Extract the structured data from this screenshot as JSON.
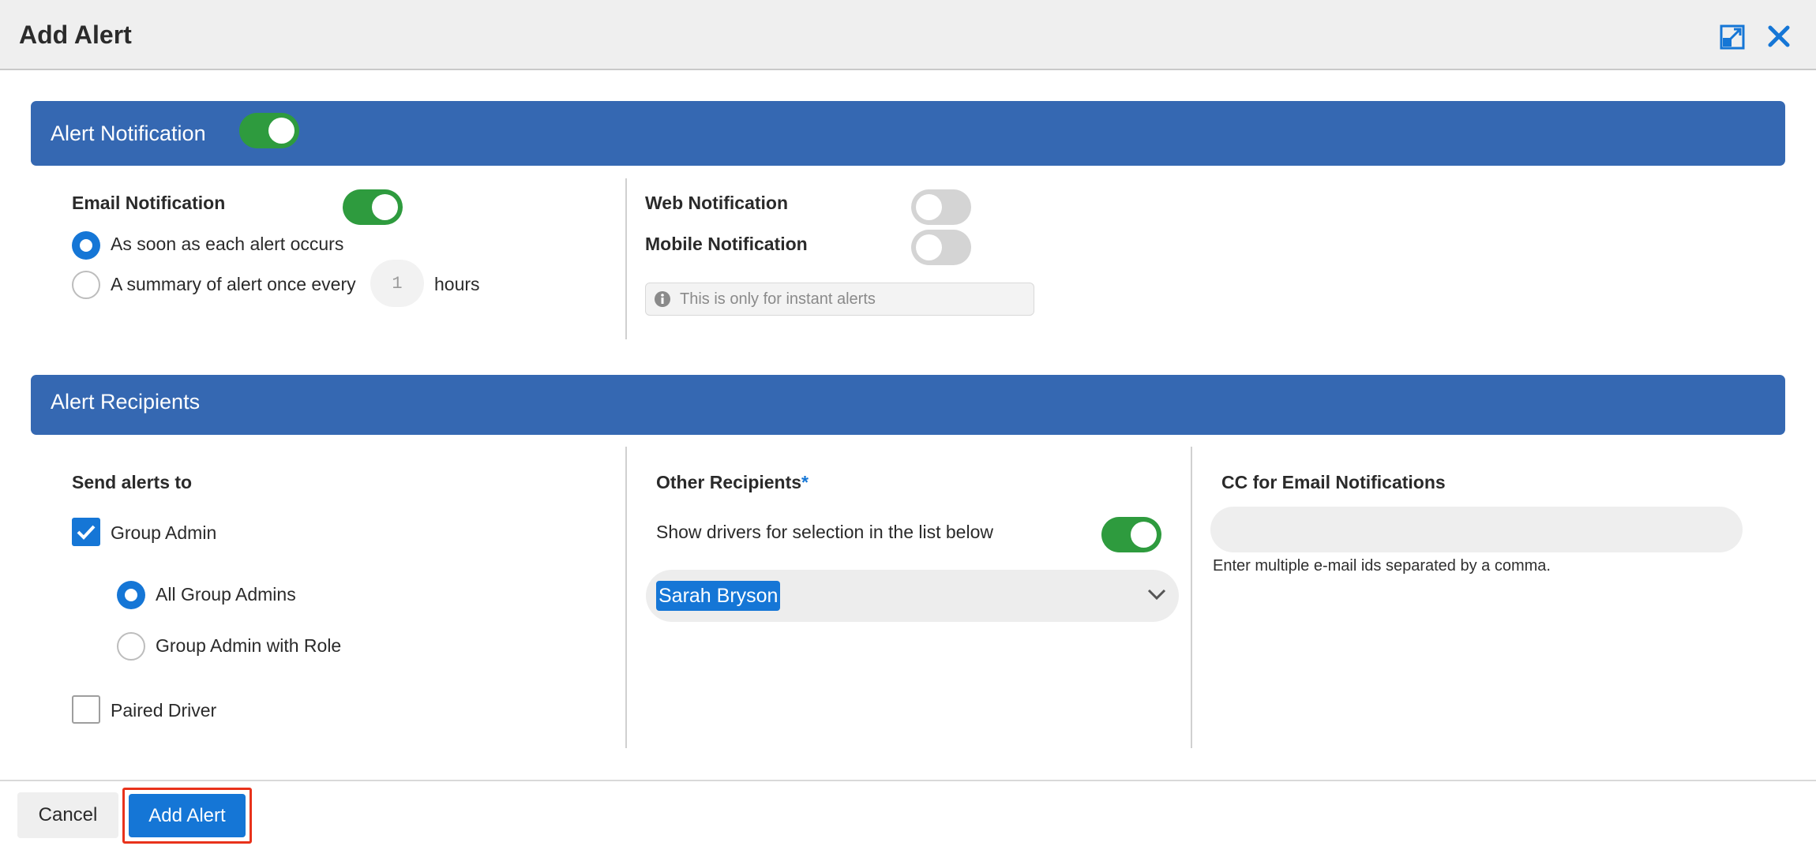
{
  "dialog": {
    "title": "Add Alert",
    "expand_icon": "expand-icon",
    "close_icon": "close-icon"
  },
  "alert_notification": {
    "section_title": "Alert Notification",
    "enabled": true,
    "email": {
      "label": "Email Notification",
      "enabled": true,
      "option_instant": "As soon as each alert occurs",
      "option_summary": "A summary of alert once every",
      "summary_hours_value": "1",
      "hours_label": "hours",
      "selected": "instant"
    },
    "web": {
      "label": "Web Notification",
      "enabled": false
    },
    "mobile": {
      "label": "Mobile Notification",
      "enabled": false
    },
    "info_text": "This is only for instant alerts",
    "info_icon": "info-icon"
  },
  "alert_recipients": {
    "section_title": "Alert Recipients",
    "send_alerts_to": {
      "label": "Send alerts to",
      "group_admin": {
        "label": "Group Admin",
        "checked": true
      },
      "all_group_admins": {
        "label": "All Group Admins",
        "selected": true
      },
      "group_admin_with_role": {
        "label": "Group Admin with Role",
        "selected": false
      },
      "paired_driver": {
        "label": "Paired Driver",
        "checked": false
      }
    },
    "other_recipients": {
      "label": "Other Recipients",
      "required_mark": "*",
      "show_drivers_label": "Show drivers for selection in the list below",
      "show_drivers_enabled": true,
      "selected_recipient": "Sarah Bryson"
    },
    "cc": {
      "label": "CC for Email Notifications",
      "value": "",
      "help_text": "Enter multiple e-mail ids separated by a comma."
    }
  },
  "footer": {
    "cancel_label": "Cancel",
    "add_label": "Add Alert"
  },
  "colors": {
    "section_bar": "#3568b2",
    "toggle_on": "#2e9b3e",
    "accent": "#1576d6",
    "highlight_outline": "#e8321b"
  }
}
